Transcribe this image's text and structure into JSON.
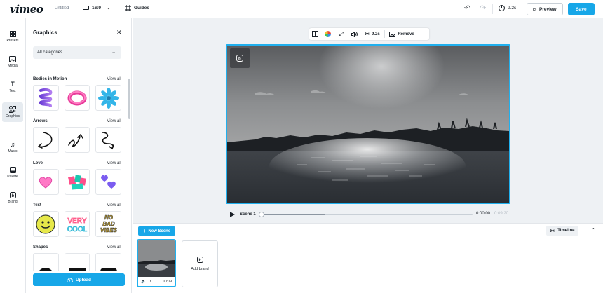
{
  "header": {
    "logo": "vimeo",
    "doc_title": "Untitled",
    "aspect_ratio": "16:9",
    "guides_label": "Guides",
    "duration": "9.2s",
    "preview_label": "Preview",
    "save_label": "Save"
  },
  "rail": {
    "items": [
      {
        "label": "Presets",
        "icon": "grid-icon"
      },
      {
        "label": "Media",
        "icon": "image-icon"
      },
      {
        "label": "Text",
        "icon": "text-icon"
      },
      {
        "label": "Graphics",
        "icon": "shapes-icon",
        "active": true
      },
      {
        "label": "Music",
        "icon": "music-icon"
      },
      {
        "label": "Palette",
        "icon": "palette-icon"
      },
      {
        "label": "Brand",
        "icon": "brand-icon"
      }
    ]
  },
  "panel": {
    "title": "Graphics",
    "category": "All categories",
    "sections": [
      {
        "name": "Bodies in Motion",
        "view_all": "View all"
      },
      {
        "name": "Arrows",
        "view_all": "View all"
      },
      {
        "name": "Love",
        "view_all": "View all"
      },
      {
        "name": "Text",
        "view_all": "View all"
      },
      {
        "name": "Shapes",
        "view_all": "View all"
      }
    ],
    "text_stickers": [
      "VERY",
      "COOL",
      "NO",
      "BAD",
      "VIBES"
    ],
    "upload_label": "Upload"
  },
  "toolbar": {
    "duration": "9.2s",
    "remove_label": "Remove"
  },
  "player": {
    "scene_label": "Scene 1",
    "current_time": "0:00.00",
    "total_time": "0:09.20",
    "progress": 0.3
  },
  "timeline": {
    "new_scene_label": "New Scene",
    "toggle_label": "Timeline",
    "scene_duration": "00:09",
    "add_brand_label": "Add brand"
  },
  "colors": {
    "accent": "#17a7e8",
    "selection": "#20b0ee"
  }
}
